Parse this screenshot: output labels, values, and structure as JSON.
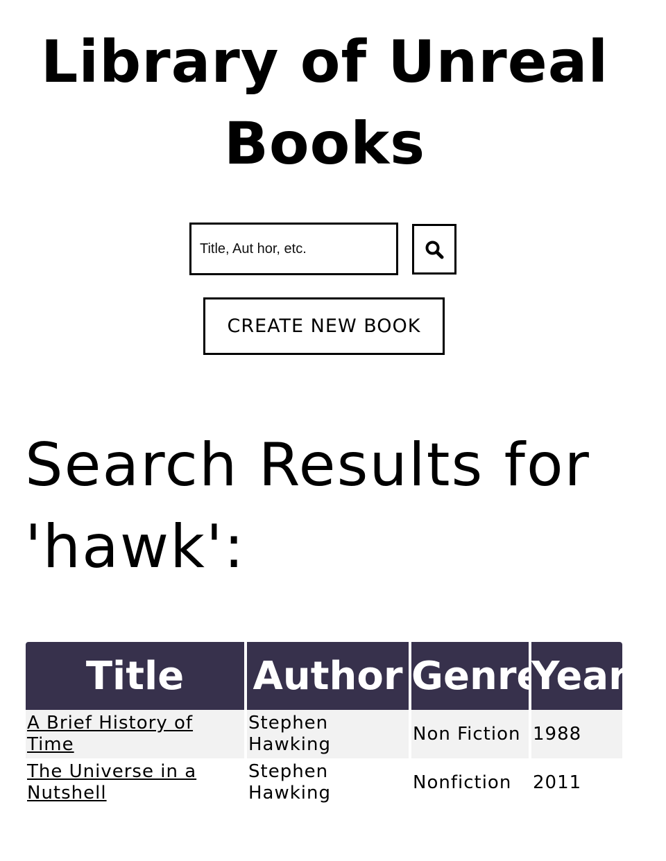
{
  "header": {
    "title": "Library of Unreal Books"
  },
  "search": {
    "placeholder": "Title, Aut hor, etc.",
    "value": "",
    "button_icon": "search-icon"
  },
  "actions": {
    "create_label": "CREATE NEW BOOK"
  },
  "results": {
    "heading": "Search Results for 'hawk':",
    "columns": [
      "Title",
      "Author",
      "Genre",
      "Year"
    ],
    "rows": [
      {
        "title": "A Brief History of Time",
        "author": "Stephen Hawking",
        "genre": "Non Fiction",
        "year": "1988"
      },
      {
        "title": "The Universe in a Nutshell",
        "author": "Stephen Hawking",
        "genre": "Nonfiction",
        "year": "2011"
      }
    ]
  },
  "colors": {
    "table_header_bg": "#37314c",
    "table_header_text": "#ffffff",
    "row_alt_bg": "#f2f2f2",
    "border": "#000000"
  }
}
